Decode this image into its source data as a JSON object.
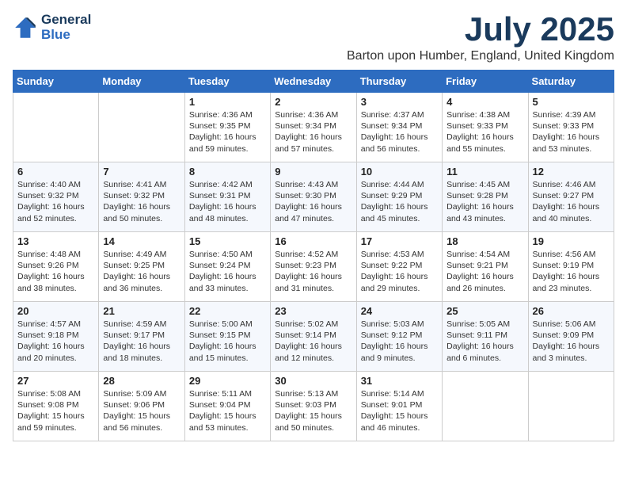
{
  "header": {
    "logo_line1": "General",
    "logo_line2": "Blue",
    "month_title": "July 2025",
    "location": "Barton upon Humber, England, United Kingdom"
  },
  "days_of_week": [
    "Sunday",
    "Monday",
    "Tuesday",
    "Wednesday",
    "Thursday",
    "Friday",
    "Saturday"
  ],
  "weeks": [
    [
      {
        "day": "",
        "info": ""
      },
      {
        "day": "",
        "info": ""
      },
      {
        "day": "1",
        "info": "Sunrise: 4:36 AM\nSunset: 9:35 PM\nDaylight: 16 hours\nand 59 minutes."
      },
      {
        "day": "2",
        "info": "Sunrise: 4:36 AM\nSunset: 9:34 PM\nDaylight: 16 hours\nand 57 minutes."
      },
      {
        "day": "3",
        "info": "Sunrise: 4:37 AM\nSunset: 9:34 PM\nDaylight: 16 hours\nand 56 minutes."
      },
      {
        "day": "4",
        "info": "Sunrise: 4:38 AM\nSunset: 9:33 PM\nDaylight: 16 hours\nand 55 minutes."
      },
      {
        "day": "5",
        "info": "Sunrise: 4:39 AM\nSunset: 9:33 PM\nDaylight: 16 hours\nand 53 minutes."
      }
    ],
    [
      {
        "day": "6",
        "info": "Sunrise: 4:40 AM\nSunset: 9:32 PM\nDaylight: 16 hours\nand 52 minutes."
      },
      {
        "day": "7",
        "info": "Sunrise: 4:41 AM\nSunset: 9:32 PM\nDaylight: 16 hours\nand 50 minutes."
      },
      {
        "day": "8",
        "info": "Sunrise: 4:42 AM\nSunset: 9:31 PM\nDaylight: 16 hours\nand 48 minutes."
      },
      {
        "day": "9",
        "info": "Sunrise: 4:43 AM\nSunset: 9:30 PM\nDaylight: 16 hours\nand 47 minutes."
      },
      {
        "day": "10",
        "info": "Sunrise: 4:44 AM\nSunset: 9:29 PM\nDaylight: 16 hours\nand 45 minutes."
      },
      {
        "day": "11",
        "info": "Sunrise: 4:45 AM\nSunset: 9:28 PM\nDaylight: 16 hours\nand 43 minutes."
      },
      {
        "day": "12",
        "info": "Sunrise: 4:46 AM\nSunset: 9:27 PM\nDaylight: 16 hours\nand 40 minutes."
      }
    ],
    [
      {
        "day": "13",
        "info": "Sunrise: 4:48 AM\nSunset: 9:26 PM\nDaylight: 16 hours\nand 38 minutes."
      },
      {
        "day": "14",
        "info": "Sunrise: 4:49 AM\nSunset: 9:25 PM\nDaylight: 16 hours\nand 36 minutes."
      },
      {
        "day": "15",
        "info": "Sunrise: 4:50 AM\nSunset: 9:24 PM\nDaylight: 16 hours\nand 33 minutes."
      },
      {
        "day": "16",
        "info": "Sunrise: 4:52 AM\nSunset: 9:23 PM\nDaylight: 16 hours\nand 31 minutes."
      },
      {
        "day": "17",
        "info": "Sunrise: 4:53 AM\nSunset: 9:22 PM\nDaylight: 16 hours\nand 29 minutes."
      },
      {
        "day": "18",
        "info": "Sunrise: 4:54 AM\nSunset: 9:21 PM\nDaylight: 16 hours\nand 26 minutes."
      },
      {
        "day": "19",
        "info": "Sunrise: 4:56 AM\nSunset: 9:19 PM\nDaylight: 16 hours\nand 23 minutes."
      }
    ],
    [
      {
        "day": "20",
        "info": "Sunrise: 4:57 AM\nSunset: 9:18 PM\nDaylight: 16 hours\nand 20 minutes."
      },
      {
        "day": "21",
        "info": "Sunrise: 4:59 AM\nSunset: 9:17 PM\nDaylight: 16 hours\nand 18 minutes."
      },
      {
        "day": "22",
        "info": "Sunrise: 5:00 AM\nSunset: 9:15 PM\nDaylight: 16 hours\nand 15 minutes."
      },
      {
        "day": "23",
        "info": "Sunrise: 5:02 AM\nSunset: 9:14 PM\nDaylight: 16 hours\nand 12 minutes."
      },
      {
        "day": "24",
        "info": "Sunrise: 5:03 AM\nSunset: 9:12 PM\nDaylight: 16 hours\nand 9 minutes."
      },
      {
        "day": "25",
        "info": "Sunrise: 5:05 AM\nSunset: 9:11 PM\nDaylight: 16 hours\nand 6 minutes."
      },
      {
        "day": "26",
        "info": "Sunrise: 5:06 AM\nSunset: 9:09 PM\nDaylight: 16 hours\nand 3 minutes."
      }
    ],
    [
      {
        "day": "27",
        "info": "Sunrise: 5:08 AM\nSunset: 9:08 PM\nDaylight: 15 hours\nand 59 minutes."
      },
      {
        "day": "28",
        "info": "Sunrise: 5:09 AM\nSunset: 9:06 PM\nDaylight: 15 hours\nand 56 minutes."
      },
      {
        "day": "29",
        "info": "Sunrise: 5:11 AM\nSunset: 9:04 PM\nDaylight: 15 hours\nand 53 minutes."
      },
      {
        "day": "30",
        "info": "Sunrise: 5:13 AM\nSunset: 9:03 PM\nDaylight: 15 hours\nand 50 minutes."
      },
      {
        "day": "31",
        "info": "Sunrise: 5:14 AM\nSunset: 9:01 PM\nDaylight: 15 hours\nand 46 minutes."
      },
      {
        "day": "",
        "info": ""
      },
      {
        "day": "",
        "info": ""
      }
    ]
  ]
}
